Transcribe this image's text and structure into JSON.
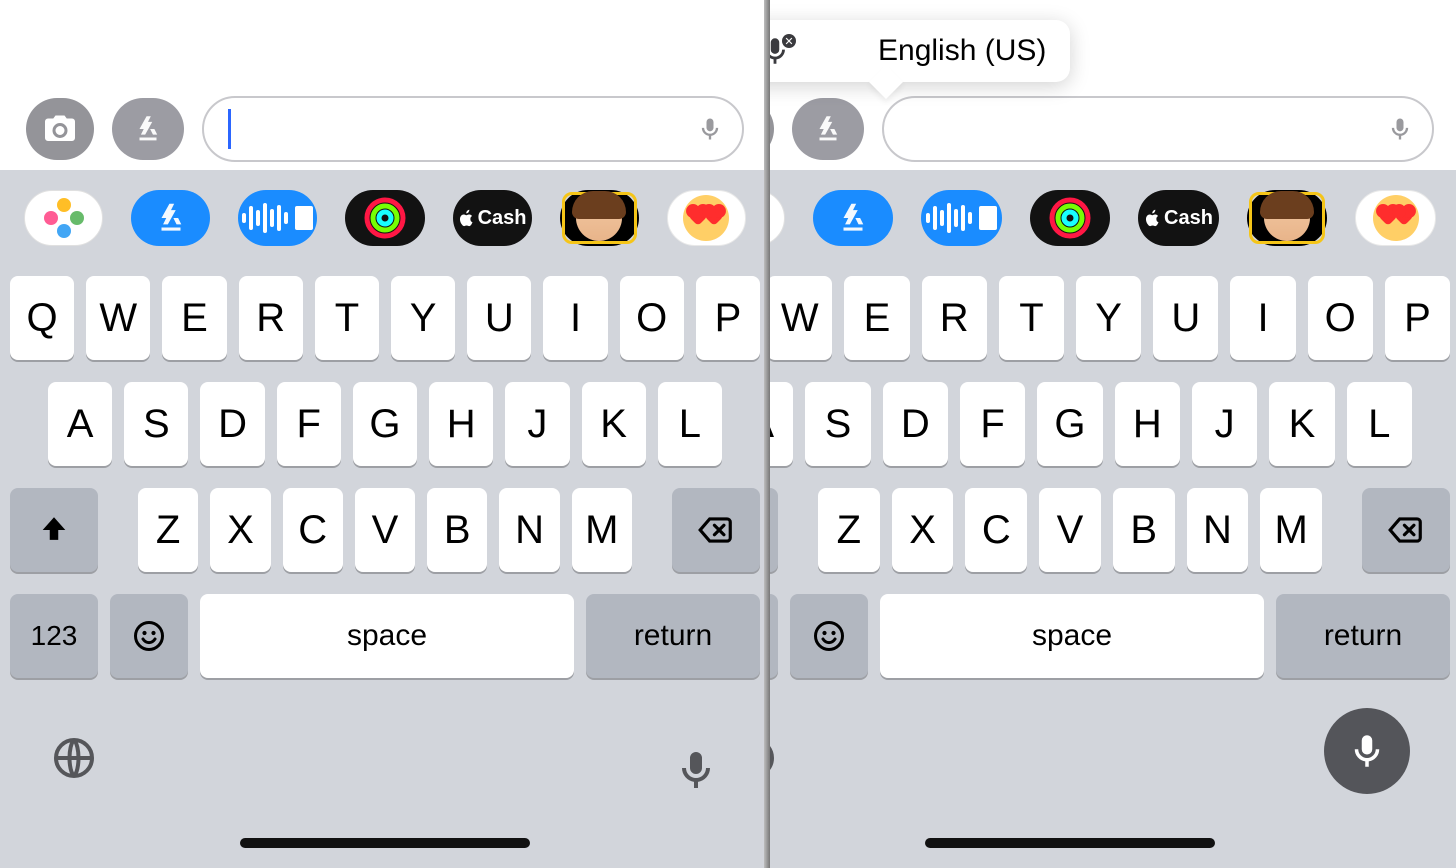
{
  "popover": {
    "language": "English (US)"
  },
  "apps": {
    "cash_label": "Cash",
    "items": [
      "photos",
      "app-store",
      "audio-message",
      "activity-rings",
      "apple-cash",
      "memoji",
      "stickers"
    ]
  },
  "keyboard": {
    "row1": [
      "Q",
      "W",
      "E",
      "R",
      "T",
      "Y",
      "U",
      "I",
      "O",
      "P"
    ],
    "row2": [
      "A",
      "S",
      "D",
      "F",
      "G",
      "H",
      "J",
      "K",
      "L"
    ],
    "row3": [
      "Z",
      "X",
      "C",
      "V",
      "B",
      "N",
      "M"
    ],
    "numeric_label": "123",
    "space_label": "space",
    "return_label": "return"
  }
}
